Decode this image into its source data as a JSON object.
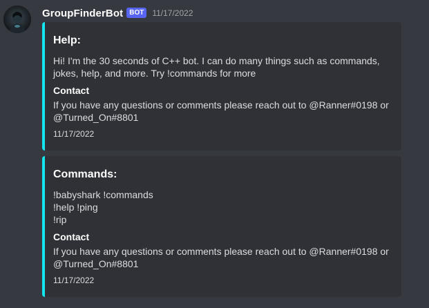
{
  "message": {
    "author": "GroupFinderBot",
    "tag": "BOT",
    "timestamp": "11/17/2022"
  },
  "embeds": [
    {
      "title": "Help:",
      "description": "Hi! I'm the 30 seconds of C++ bot. I can do many things such as commands, jokes, help, and more. Try !commands for more",
      "field": {
        "name": "Contact",
        "value_lines": [
          "If you have any questions or comments please reach out to @Ranner#0198 or",
          "@Turned_On#8801"
        ]
      },
      "footer": "11/17/2022"
    },
    {
      "title": "Commands:",
      "description_lines": [
        "!babyshark !commands",
        "!help !ping",
        "!rip"
      ],
      "field": {
        "name": "Contact",
        "value_lines": [
          "If you have any questions or comments please reach out to @Ranner#0198 or",
          "@Turned_On#8801"
        ]
      },
      "footer": "11/17/2022"
    }
  ],
  "colors": {
    "background": "#36393f",
    "embed_background": "#2f3136",
    "embed_accent": "#14e6f0",
    "bot_tag": "#5865f2"
  }
}
